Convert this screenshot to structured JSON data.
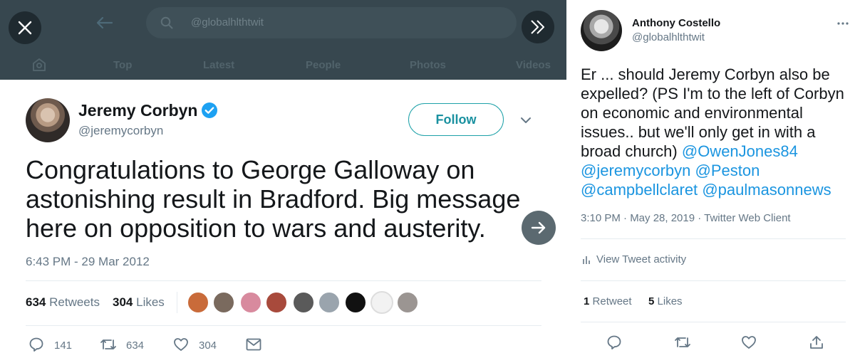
{
  "search": {
    "query": "@globalhlthtwit"
  },
  "search_tabs": [
    "Top",
    "Latest",
    "People",
    "Photos",
    "Videos"
  ],
  "main_tweet": {
    "author_name": "Jeremy Corbyn",
    "author_handle": "@jeremycorbyn",
    "follow_label": "Follow",
    "text": "Congratulations to George Galloway on astonishing result in Bradford. Big message here on opposition to wars and austerity.",
    "timestamp": "6:43 PM - 29 Mar 2012",
    "retweets_count": "634",
    "retweets_label": "Retweets",
    "likes_count": "304",
    "likes_label": "Likes",
    "actions": {
      "replies": "141",
      "retweets": "634",
      "likes": "304"
    }
  },
  "side_tweet": {
    "author_name": "Anthony Costello",
    "author_handle": "@globalhlthtwit",
    "text_plain": "Er ... should Jeremy Corbyn also be expelled? (PS I'm to the left of Corbyn on economic and environmental issues.. but we'll only get in with a broad church) ",
    "mentions": [
      "@OwenJones84",
      "@jeremycorbyn",
      "@Peston",
      "@campbellclaret",
      "@paulmasonnews"
    ],
    "meta": "3:10 PM · May 28, 2019 · Twitter Web Client",
    "activity_label": "View Tweet activity",
    "retweet_count": "1",
    "retweet_label": "Retweet",
    "likes_count": "5",
    "likes_label": "Likes"
  },
  "colors": {
    "accent": "#1b95e0",
    "follow": "#1a91a0",
    "topbar": "#37474f",
    "muted": "#657786"
  }
}
